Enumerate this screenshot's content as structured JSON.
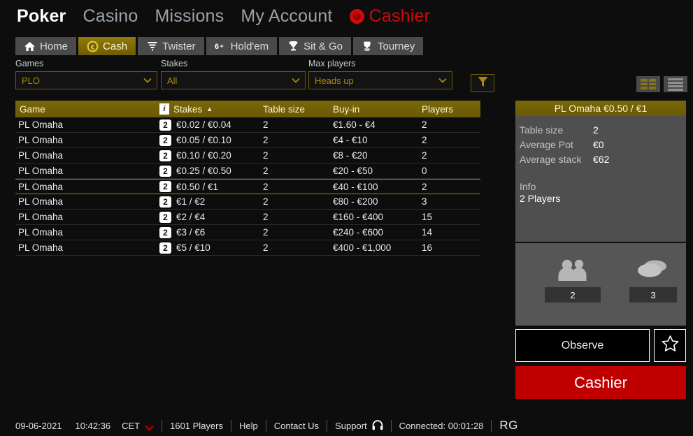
{
  "topnav": {
    "items": [
      {
        "label": "Poker",
        "active": true,
        "icon": null
      },
      {
        "label": "Casino",
        "active": false,
        "icon": null
      },
      {
        "label": "Missions",
        "active": false,
        "icon": null
      },
      {
        "label": "My Account",
        "active": false,
        "icon": null
      },
      {
        "label": "Cashier",
        "active": false,
        "icon": "poker-chip-icon"
      }
    ]
  },
  "tabs": [
    {
      "label": "Home",
      "icon": "house-icon",
      "active": false
    },
    {
      "label": "Cash",
      "icon": "euro-chip-icon",
      "active": true
    },
    {
      "label": "Twister",
      "icon": "twister-icon",
      "active": false
    },
    {
      "label": "Hold'em",
      "icon": "six-plus-icon",
      "active": false
    },
    {
      "label": "Sit & Go",
      "icon": "trophy-icon",
      "active": false
    },
    {
      "label": "Tourney",
      "icon": "cup-icon",
      "active": false
    }
  ],
  "filters": {
    "games": {
      "label": "Games",
      "value": "PLO",
      "placeholder": "PLO"
    },
    "stakes": {
      "label": "Stakes",
      "value": "All",
      "placeholder": "All"
    },
    "max_players": {
      "label": "Max players",
      "value": "Heads up",
      "placeholder": "Heads up"
    },
    "funnel_icon": "funnel-filter-icon"
  },
  "view_toggles": {
    "grid_label": "grid-view-icon",
    "list_label": "list-view-icon",
    "active": "grid"
  },
  "table": {
    "columns": [
      "Game",
      "Stakes",
      "Table size",
      "Buy-in",
      "Players"
    ],
    "sort_column": "Stakes",
    "sort_direction": "▲",
    "info_badge": "i",
    "rows": [
      {
        "game": "PL Omaha",
        "badge": "2",
        "stakes": "€0.02 / €0.04",
        "table_size": "2",
        "buy_in": "€1.60 - €4",
        "players": "2",
        "selected": false
      },
      {
        "game": "PL Omaha",
        "badge": "2",
        "stakes": "€0.05 / €0.10",
        "table_size": "2",
        "buy_in": "€4 - €10",
        "players": "2",
        "selected": false
      },
      {
        "game": "PL Omaha",
        "badge": "2",
        "stakes": "€0.10 / €0.20",
        "table_size": "2",
        "buy_in": "€8 - €20",
        "players": "2",
        "selected": false
      },
      {
        "game": "PL Omaha",
        "badge": "2",
        "stakes": "€0.25 / €0.50",
        "table_size": "2",
        "buy_in": "€20 - €50",
        "players": "0",
        "selected": false
      },
      {
        "game": "PL Omaha",
        "badge": "2",
        "stakes": "€0.50 / €1",
        "table_size": "2",
        "buy_in": "€40 - €100",
        "players": "2",
        "selected": true
      },
      {
        "game": "PL Omaha",
        "badge": "2",
        "stakes": "€1 / €2",
        "table_size": "2",
        "buy_in": "€80 - €200",
        "players": "3",
        "selected": false
      },
      {
        "game": "PL Omaha",
        "badge": "2",
        "stakes": "€2 / €4",
        "table_size": "2",
        "buy_in": "€160 - €400",
        "players": "15",
        "selected": false
      },
      {
        "game": "PL Omaha",
        "badge": "2",
        "stakes": "€3 / €6",
        "table_size": "2",
        "buy_in": "€240 - €600",
        "players": "14",
        "selected": false
      },
      {
        "game": "PL Omaha",
        "badge": "2",
        "stakes": "€5 / €10",
        "table_size": "2",
        "buy_in": "€400 - €1,000",
        "players": "16",
        "selected": false
      }
    ]
  },
  "detail_panel": {
    "title": "PL Omaha €0.50 / €1",
    "stats": [
      {
        "key": "Table size",
        "value": "2"
      },
      {
        "key": "Average Pot",
        "value": "€0"
      },
      {
        "key": "Average stack",
        "value": "€62"
      }
    ],
    "info_label": "Info",
    "info_value": "2 Players",
    "counters": {
      "players_icon": "people-icon",
      "players_count": "2",
      "tables_icon": "tables-icon",
      "tables_count": "3"
    },
    "observe_label": "Observe",
    "favorite_icon": "star-icon",
    "cashier_label": "Cashier"
  },
  "statusbar": {
    "date": "09-06-2021",
    "time": "10:42:36",
    "timezone": "CET",
    "timezone_caret_icon": "chevron-down-red-icon",
    "players_online": "1601 Players",
    "help": "Help",
    "contact": "Contact Us",
    "support": "Support",
    "support_icon": "headset-icon",
    "connected": "Connected: 00:01:28",
    "rg": "RG"
  },
  "colors": {
    "background": "#0d0d0d",
    "gold": "#6d5c06",
    "gold_text": "#a8880f",
    "accent_red": "#c00000",
    "cashier_red": "#cf0a0a",
    "panel_gray": "#4f4f4f",
    "stats_gray": "#565656",
    "tab_gray": "#4a4a4a"
  }
}
